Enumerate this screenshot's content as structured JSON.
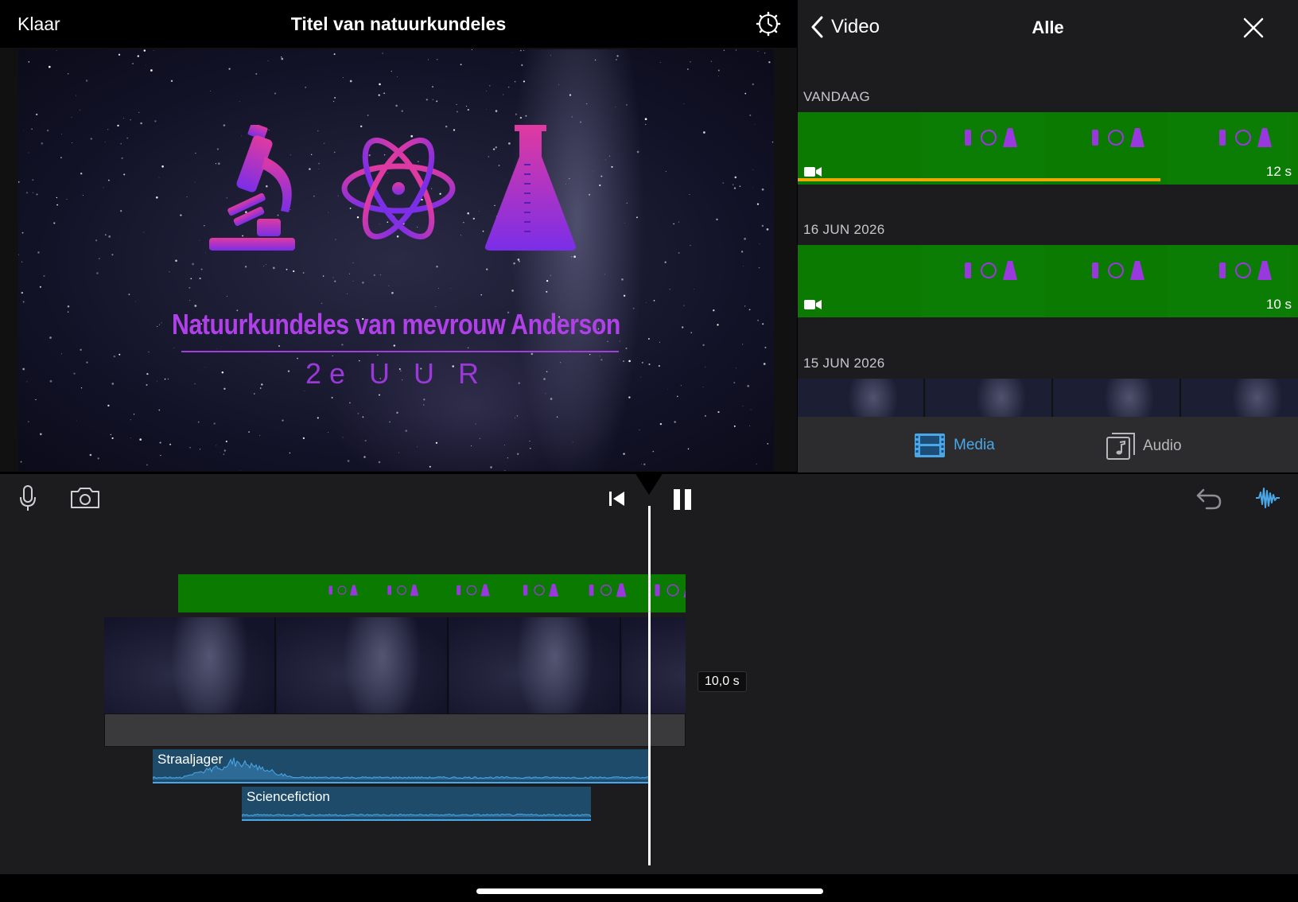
{
  "header": {
    "done_label": "Klaar",
    "project_title": "Titel van natuurkundeles",
    "settings_icon": "gear-icon"
  },
  "preview": {
    "title_line1": "Natuurkundeles van mevrouw Anderson",
    "title_line2": "2e U U R",
    "title_color": "#b040e8"
  },
  "browser": {
    "back_label": "Video",
    "title": "Alle",
    "sections": [
      {
        "label": "VANDAAG",
        "duration": "12 s"
      },
      {
        "label": "16 JUN 2026",
        "duration": "10 s"
      },
      {
        "label": "15 JUN 2026",
        "duration": ""
      }
    ],
    "tabs": {
      "media": "Media",
      "audio": "Audio"
    },
    "accent_color": "#4aa8e8"
  },
  "timeline": {
    "clip_duration": "10,0 s",
    "audio_clips": [
      {
        "label": "Straaljager"
      },
      {
        "label": "Sciencefiction"
      }
    ]
  }
}
